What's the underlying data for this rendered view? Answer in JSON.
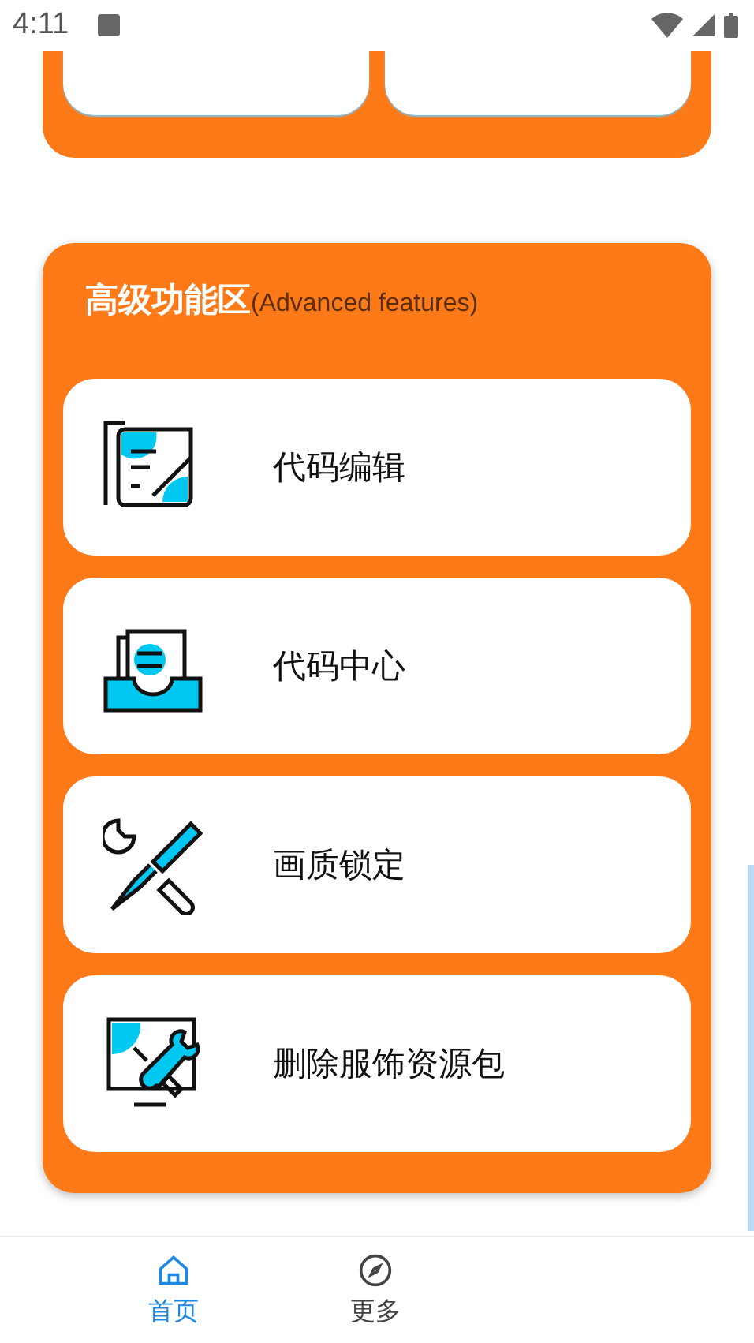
{
  "status_bar": {
    "time": "4:11"
  },
  "top_section": {
    "cards": [
      {
        "kind": "card"
      },
      {
        "kind": "card"
      }
    ]
  },
  "advanced": {
    "title": "高级功能区",
    "subtitle": "(Advanced features)",
    "items": [
      {
        "label": "代码编辑",
        "kind": "edit"
      },
      {
        "label": "代码中心",
        "kind": "inbox"
      },
      {
        "label": "画质锁定",
        "kind": "tools"
      },
      {
        "label": "删除服饰资源包",
        "kind": "monitor"
      }
    ]
  },
  "bottom_nav": [
    {
      "label": "首页",
      "kind": "home",
      "selected": true
    },
    {
      "label": "更多",
      "kind": "compass",
      "selected": false
    }
  ]
}
